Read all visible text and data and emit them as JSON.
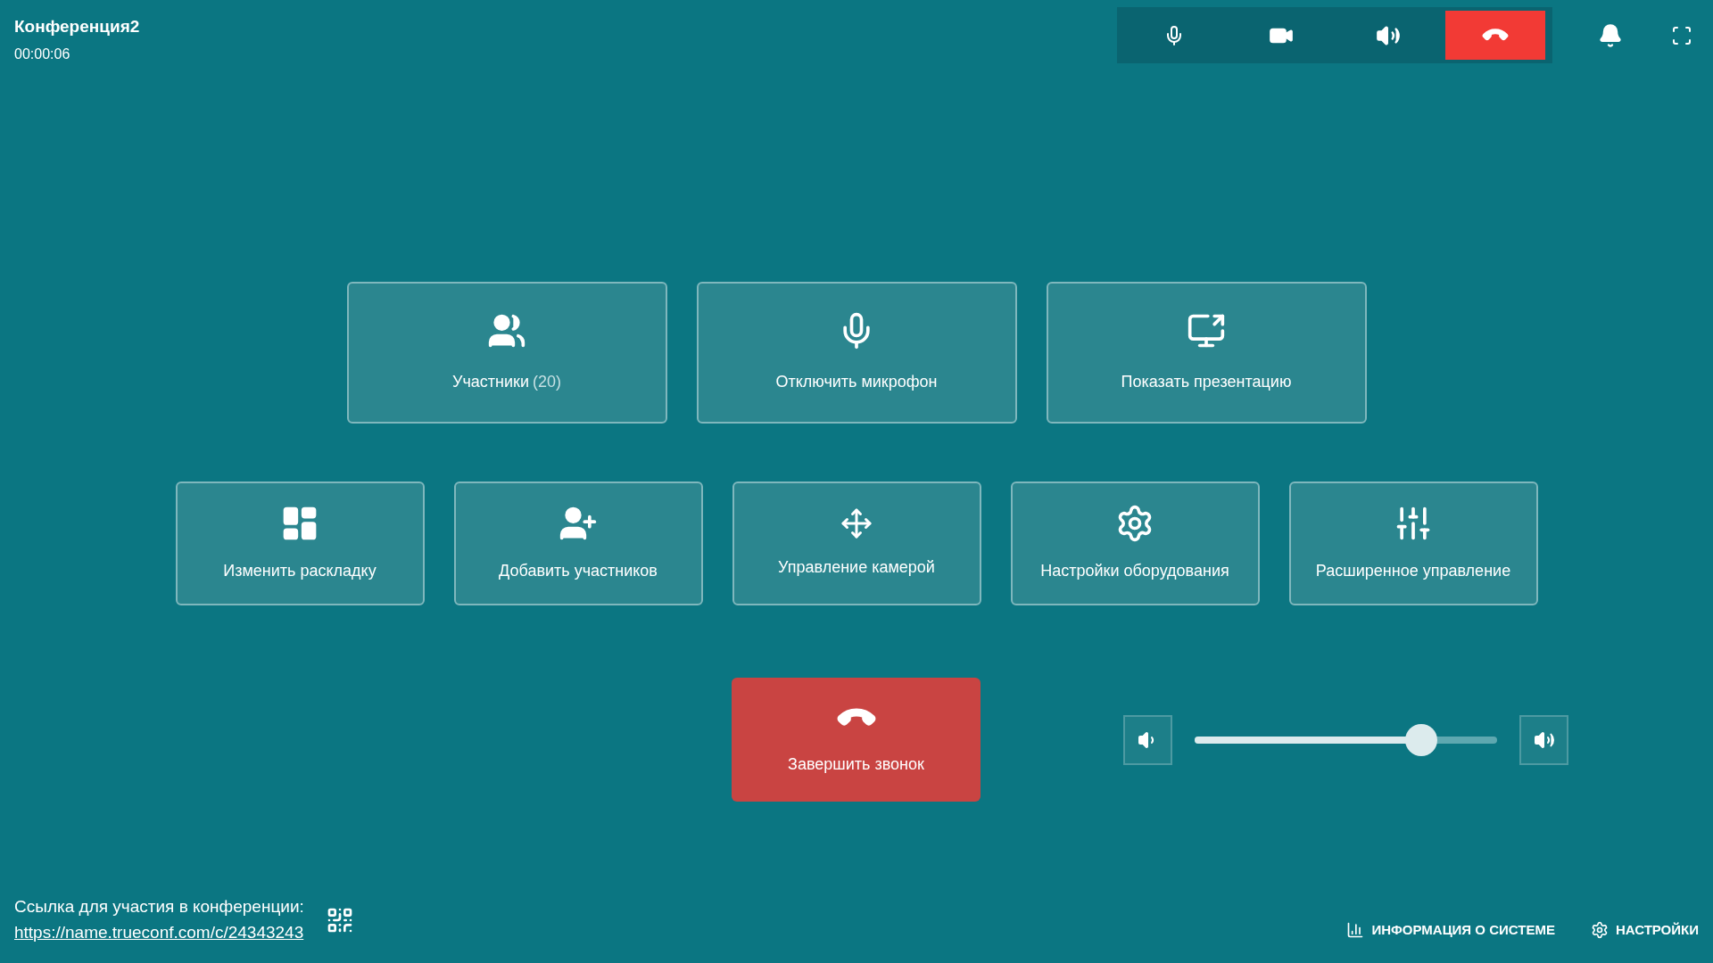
{
  "header": {
    "title": "Конференция2",
    "duration": "00:00:06"
  },
  "top_controls": [
    {
      "kind": "mic"
    },
    {
      "kind": "camera"
    },
    {
      "kind": "speaker"
    },
    {
      "kind": "hangup"
    }
  ],
  "top_icons": [
    {
      "kind": "bell"
    },
    {
      "kind": "fullscreen"
    }
  ],
  "main_actions": [
    {
      "kind": "participants",
      "label": "Участники",
      "count": "(20)"
    },
    {
      "kind": "mic",
      "label": "Отключить микрофон"
    },
    {
      "kind": "present",
      "label": "Показать презентацию"
    }
  ],
  "secondary_actions": [
    {
      "kind": "layout",
      "label": "Изменить раскладку"
    },
    {
      "kind": "add",
      "label": "Добавить участников"
    },
    {
      "kind": "camera",
      "label": "Управление камерой"
    },
    {
      "kind": "hardware",
      "label": "Настройки оборудования"
    },
    {
      "kind": "advanced",
      "label": "Расширенное управление"
    }
  ],
  "end_call": {
    "label": "Завершить звонок"
  },
  "volume": {
    "level": 0.75
  },
  "footer": {
    "link_caption": "Ссылка для участия в конференции:",
    "link": "https://name.trueconf.com/c/24343243",
    "system_info": "ИНФОРМАЦИЯ О СИСТЕМЕ",
    "settings": "НАСТРОЙКИ"
  }
}
